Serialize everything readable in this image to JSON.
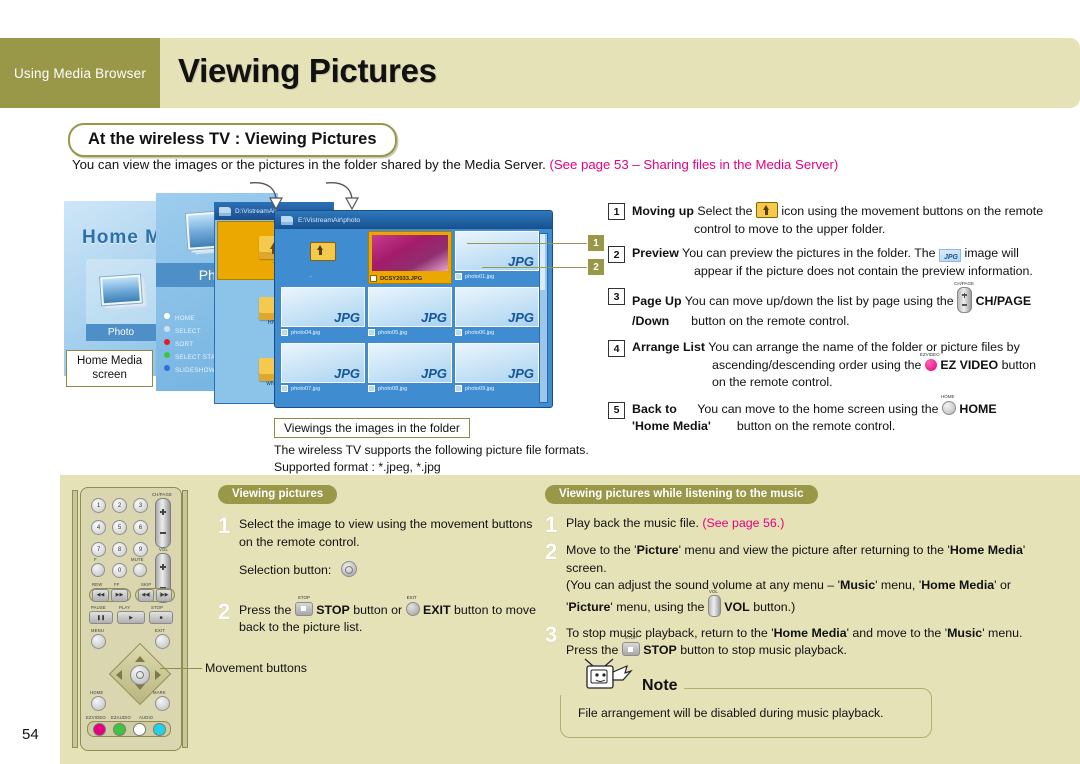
{
  "header": {
    "chapter": "Using Media Browser",
    "title": "Viewing Pictures"
  },
  "section": {
    "pill": "At the wireless TV : Viewing Pictures",
    "intro_main": "You can view the images or the pictures in the folder shared by the Media Server.",
    "intro_ref": "(See page 53 – Sharing files in the Media Server)"
  },
  "montage": {
    "home_caption_line1": "Home Media",
    "home_caption_line2": "screen",
    "home_title": "Home Media",
    "home_tile_label": "Photo",
    "photo_menu_label": "Photo",
    "photo_menu2_label": "Photo",
    "folder_titlebar": "D:\\VistreamAir",
    "thumb_titlebar": "E:\\VistreamAir\\photo",
    "legend": [
      {
        "label": "HOME",
        "color": "#ffffff"
      },
      {
        "label": "SELECT",
        "color": "#cfe3f3"
      },
      {
        "label": "SORT",
        "color": "#e02020"
      },
      {
        "label": "SELECT START",
        "color": "#3fc43f"
      },
      {
        "label": "SLIDESHOW",
        "color": "#2f6fd8"
      }
    ],
    "folders": [
      "..",
      "RM1",
      "wNo5"
    ],
    "selected_file": "DCSY2033.JPG",
    "files": [
      "photo01.jpg",
      "photo04.jpg",
      "photo05.jpg",
      "photo06.jpg",
      "photo07.jpg",
      "photo08.jpg",
      "photo09.jpg"
    ],
    "jpg_badge": "JPG",
    "callouts": [
      "1",
      "2"
    ]
  },
  "instructions": [
    {
      "num": "1",
      "title": "Moving up",
      "before": " Select the ",
      "glyph": "up-folder-icon",
      "after": " icon using the movement buttons on the remote",
      "line2": "control to move to the upper folder."
    },
    {
      "num": "2",
      "title": "Preview",
      "before": " You can preview the pictures in the folder. The ",
      "glyph": "jpg-thumb-icon",
      "after": " image will",
      "line2": "appear if  the picture does not contain the preview information."
    },
    {
      "num": "3",
      "title": "Page Up",
      "title2": "/Down",
      "before": "  You can move up/down the list by page using the ",
      "glyph": "chpage-rocker-icon",
      "glyph_label": "CH/PAGE",
      "after": "",
      "line2": "button on the remote control."
    },
    {
      "num": "4",
      "title": "Arrange List",
      "before": " You can arrange the name of the folder or picture files by",
      "line2_a": "ascending/descending order using the ",
      "glyph": "ezvideo-button-icon",
      "glyph_label": "EZ VIDEO",
      "line2_b": " button",
      "line3": "on the remote control."
    },
    {
      "num": "5",
      "title": "Back to",
      "title2": "'Home Media'",
      "before": "      You can move to the home screen using the ",
      "glyph": "home-button-icon",
      "glyph_label": "HOME",
      "line2": "button on the remote control."
    }
  ],
  "folder_note": {
    "box_label": "Viewings the images in the folder",
    "line1": "The wireless TV supports the following picture file formats.",
    "line2": "Supported format : *.jpeg, *.jpg"
  },
  "remote": {
    "numbers": [
      "1",
      "2",
      "3",
      "4",
      "5",
      "6",
      "7",
      "8",
      "9",
      "0"
    ],
    "labels": {
      "chpage": "CH/PAGE",
      "vol": "VOL",
      "mute": "MUTE",
      "flash": "F",
      "rew": "REW",
      "ff": "FF",
      "skip": "SKIP",
      "pause": "PAUSE",
      "play": "PLAY",
      "stop": "STOP",
      "menu": "MENU",
      "exit": "EXIT",
      "home": "HOME",
      "mark": "MARK",
      "ezvideo": "EZVIDEO",
      "ezaudio": "EZAUDIO",
      "audio": "AUDIO"
    },
    "color_buttons": [
      "#e5007f",
      "#3fc43f",
      "#ffffff",
      "#21d2e8"
    ],
    "callout_label": "Movement buttons"
  },
  "lower_left": {
    "pill": "Viewing pictures",
    "steps": [
      {
        "n": "1",
        "line1": "Select the image to view using the movement buttons",
        "line2": "on the remote control.",
        "line3_label": "Selection button:",
        "glyph": "select-button-icon"
      },
      {
        "n": "2",
        "pre": "Press the ",
        "glyph1": "stop-button-icon",
        "bold1": "STOP",
        "mid": " button or ",
        "glyph2": "exit-button-icon",
        "bold2": "EXIT",
        "post": " button to move",
        "line2": "back to the picture list."
      }
    ]
  },
  "lower_right": {
    "pill": "Viewing pictures while listening to the music",
    "steps": [
      {
        "n": "1",
        "text": "Play back the music file. ",
        "ref": "(See page 56.)"
      },
      {
        "n": "2",
        "l1a": "Move to the '",
        "l1b": "Picture",
        "l1c": "' menu and view the picture after returning to the '",
        "l1d": "Home Media",
        "l1e": "'",
        "l2": "screen.",
        "l3a": "(You can adjust the sound volume at any menu – '",
        "l3b": "Music",
        "l3c": "' menu, '",
        "l3d": "Home Media",
        "l3e": "' or",
        "l4a": "'",
        "l4b": "Picture",
        "l4c": "' menu, using the ",
        "glyph": "vol-rocker-icon",
        "l4d": "VOL",
        "l4e": " button.)"
      },
      {
        "n": "3",
        "l1a": "To stop music playback, return to the '",
        "l1b": "Home Media",
        "l1c": "' and move to the '",
        "l1d": "Music",
        "l1e": "' menu.",
        "l2a": "Press the ",
        "glyph": "stop-button-icon",
        "l2b": "STOP",
        "l2c": " button to stop music playback."
      }
    ]
  },
  "note": {
    "label": "Note",
    "text": "File arrangement will be disabled during music playback."
  },
  "page_number": "54",
  "colors": {
    "olive": "#999748",
    "cream": "#e6e2b8",
    "pink": "#e5007f",
    "tv_blue": "#3f8dd0",
    "folder_gold": "#eaa800"
  }
}
